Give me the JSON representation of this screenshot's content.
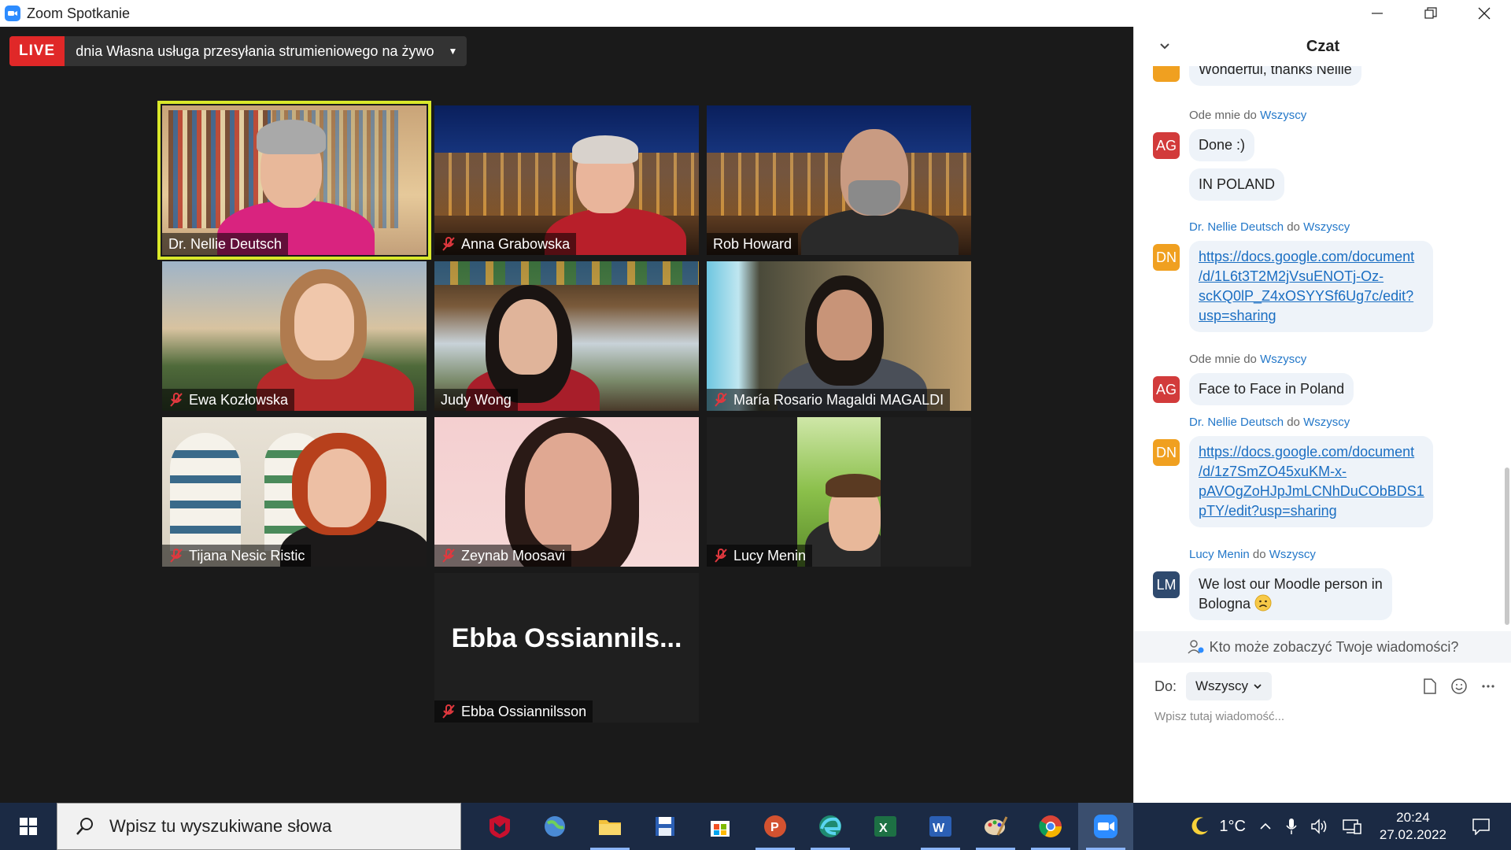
{
  "window": {
    "title": "Zoom Spotkanie"
  },
  "live": {
    "badge": "LIVE",
    "text": "dnia Własna usługa przesyłania strumieniowego na żywo"
  },
  "participants": [
    {
      "name": "Dr. Nellie Deutsch",
      "muted": false,
      "active": true
    },
    {
      "name": "Anna Grabowska",
      "muted": true
    },
    {
      "name": "Rob Howard",
      "muted": false
    },
    {
      "name": "Ewa Kozłowska",
      "muted": true
    },
    {
      "name": "Judy Wong",
      "muted": false
    },
    {
      "name": "María Rosario Magaldi MAGALDI",
      "muted": true
    },
    {
      "name": "Tijana Nesic Ristic",
      "muted": true
    },
    {
      "name": "Zeynab Moosavi",
      "muted": true
    },
    {
      "name": "Lucy Menin",
      "muted": true
    },
    {
      "name": "Ebba Ossiannilsson",
      "muted": true,
      "display_name": "Ebba  Ossiannils..."
    }
  ],
  "chat": {
    "title": "Czat",
    "messages": [
      {
        "avatar": "",
        "text": "Wonderful, thanks Nellie"
      },
      {
        "from": "Ode mnie",
        "to_word": "do",
        "to": "Wszyscy",
        "avatar": "AG",
        "texts": [
          "Done :)",
          "IN POLAND"
        ]
      },
      {
        "from": "Dr. Nellie Deutsch",
        "to_word": "do",
        "to": "Wszyscy",
        "avatar": "DN",
        "link_lines": [
          "https://docs.google.com/document",
          "/d/1L6t3T2M2jVsuENOTj-Oz-",
          "scKQ0lP_Z4xOSYYSf6Ug7c/edit?",
          "usp=sharing"
        ]
      },
      {
        "from": "Ode mnie",
        "to_word": "do",
        "to": "Wszyscy",
        "avatar": "AG",
        "text": "Face to Face in Poland"
      },
      {
        "from": "Dr. Nellie Deutsch",
        "to_word": "do",
        "to": "Wszyscy",
        "avatar": "DN",
        "link_lines": [
          "https://docs.google.com/document",
          "/d/1z7SmZO45xuKM-x-",
          "pAVOgZoHJpJmLCNhDuCObBDS1",
          "pTY/edit?usp=sharing"
        ]
      },
      {
        "from": "Lucy Menin",
        "to_word": "do",
        "to": "Wszyscy",
        "avatar": "LM",
        "text_lines": [
          "We lost our Moodle person in",
          "Bologna"
        ]
      }
    ],
    "privacy": "Kto może zobaczyć Twoje wiadomości?",
    "to_label": "Do:",
    "to_value": "Wszyscy",
    "input_placeholder": "Wpisz tutaj wiadomość..."
  },
  "taskbar": {
    "search_placeholder": "Wpisz tu wyszukiwane słowa",
    "weather": "1°C",
    "time": "20:24",
    "date": "27.02.2022"
  },
  "colors": {
    "accent": "#2d8cff",
    "live": "#e02828",
    "active_speaker": "#d9e82a",
    "chat_link": "#1a6ec2"
  }
}
